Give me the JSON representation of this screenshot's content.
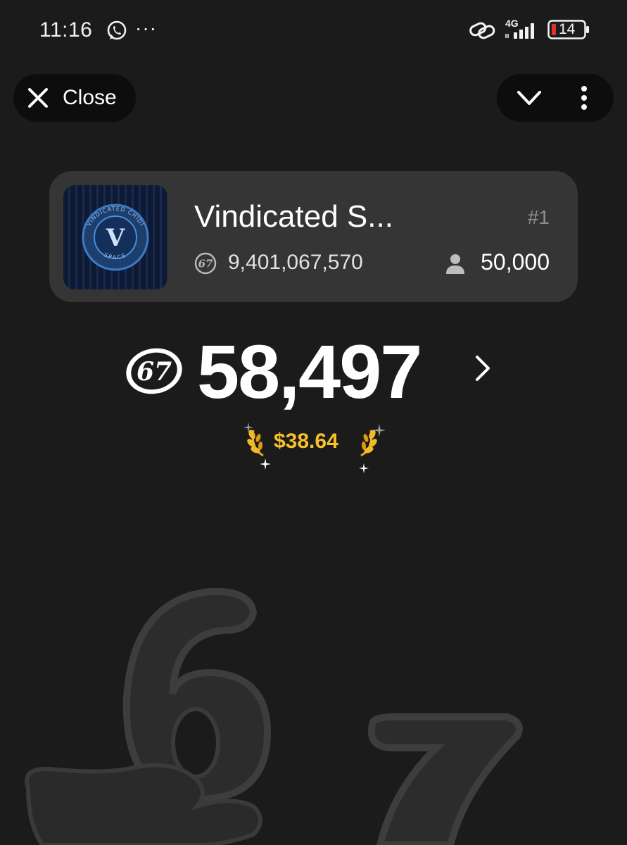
{
  "status_bar": {
    "time": "11:16",
    "more_indicator": "···",
    "network": "4G",
    "battery": "14",
    "icons": [
      "whatsapp-icon",
      "link-icon",
      "signal-icon",
      "battery-icon"
    ]
  },
  "header": {
    "close_label": "Close",
    "icons": [
      "close-icon",
      "chevron-down-icon",
      "more-vertical-icon"
    ]
  },
  "card": {
    "title": "Vindicated S...",
    "rank": "#1",
    "total": "9,401,067,570",
    "members": "50,000",
    "logo_text_top": "VINDICATED CHIDI",
    "logo_text_bottom": "SPACE",
    "logo_letter": "V"
  },
  "balance": {
    "amount": "58,497",
    "coin_label": "67",
    "usd": "$38.64"
  },
  "colors": {
    "background": "#1b1b1b",
    "card": "#353535",
    "pill": "#0d0d0d",
    "usd_accent": "#f7c12a",
    "rank": "#8e8e8e"
  }
}
